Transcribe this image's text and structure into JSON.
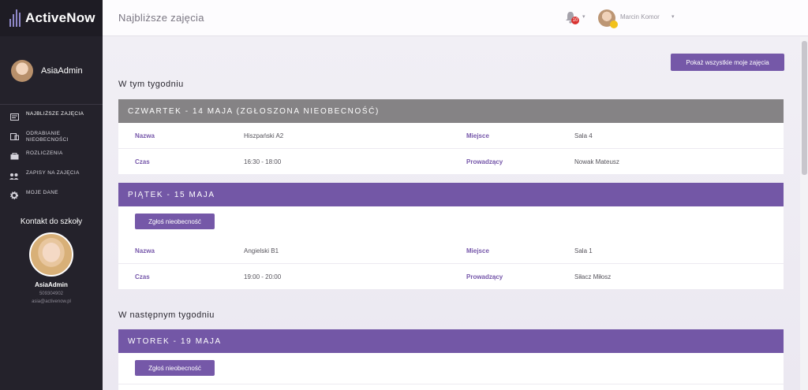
{
  "app": {
    "name": "ActiveNow"
  },
  "sidebar": {
    "user_name": "AsiaAdmin",
    "items": [
      {
        "label": "NAJBLIŻSZE ZAJĘCIA",
        "icon": "calendar-icon"
      },
      {
        "label": "ODRABIANIE NIEOBECNOŚCI",
        "icon": "clipboard-icon"
      },
      {
        "label": "ROZLICZENIA",
        "icon": "wallet-icon"
      },
      {
        "label": "ZAPISY NA ZAJĘCIA",
        "icon": "users-icon"
      },
      {
        "label": "MOJE DANE",
        "icon": "gear-icon"
      }
    ],
    "contact": {
      "title": "Kontakt do szkoły",
      "name": "AsiaAdmin",
      "phone": "509304902",
      "email": "asia@activenow.pl"
    }
  },
  "topbar": {
    "title": "Najbliższe zajęcia",
    "notifications": "10",
    "user_name": "Marcin Komor"
  },
  "main": {
    "show_all_button": "Pokaż wszystkie moje zajęcia",
    "this_week_title": "W tym tygodniu",
    "next_week_title": "W następnym tygodniu",
    "labels": {
      "name": "Nazwa",
      "place": "Miejsce",
      "time": "Czas",
      "teacher": "Prowadzący"
    },
    "report_absence_button": "Zgłoś nieobecność",
    "classes": [
      {
        "header": "CZWARTEK - 14 MAJA (ZGŁOSZONA NIEOBECNOŚĆ)",
        "name": "Hiszpański A2",
        "place": "Sala 4",
        "time": "16:30 - 18:00",
        "teacher": "Nowak Mateusz"
      },
      {
        "header": "PIĄTEK - 15 MAJA",
        "name": "Angielski B1",
        "place": "Sala 1",
        "time": "19:00 - 20:00",
        "teacher": "Siłacz Miłosz"
      },
      {
        "header": "WTOREK - 19 MAJA"
      }
    ]
  },
  "colors": {
    "accent": "#7558a8",
    "sidebar": "#24222b",
    "absence_header": "#858385"
  }
}
